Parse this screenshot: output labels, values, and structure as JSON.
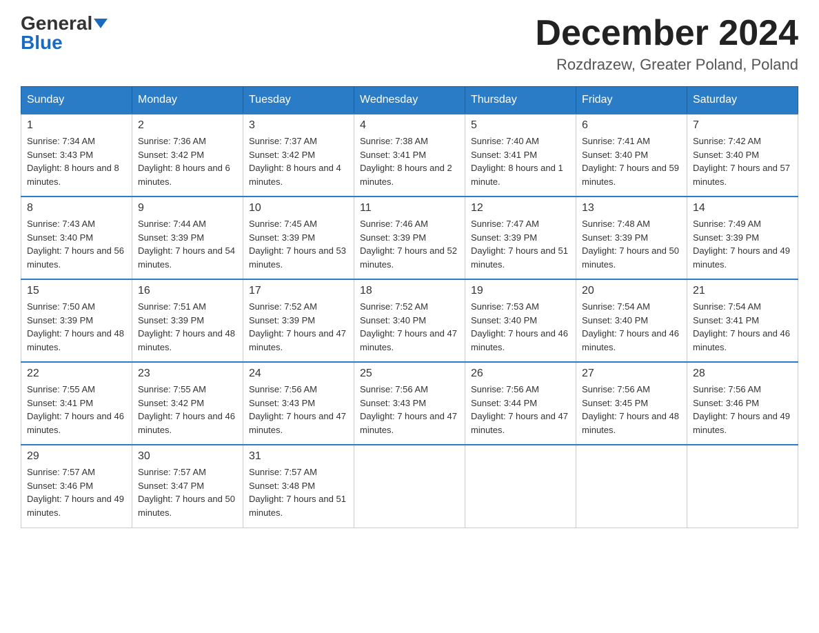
{
  "logo": {
    "general": "General",
    "blue": "Blue"
  },
  "title": "December 2024",
  "location": "Rozdrazew, Greater Poland, Poland",
  "days_of_week": [
    "Sunday",
    "Monday",
    "Tuesday",
    "Wednesday",
    "Thursday",
    "Friday",
    "Saturday"
  ],
  "weeks": [
    [
      {
        "day": "1",
        "sunrise": "7:34 AM",
        "sunset": "3:43 PM",
        "daylight": "8 hours and 8 minutes."
      },
      {
        "day": "2",
        "sunrise": "7:36 AM",
        "sunset": "3:42 PM",
        "daylight": "8 hours and 6 minutes."
      },
      {
        "day": "3",
        "sunrise": "7:37 AM",
        "sunset": "3:42 PM",
        "daylight": "8 hours and 4 minutes."
      },
      {
        "day": "4",
        "sunrise": "7:38 AM",
        "sunset": "3:41 PM",
        "daylight": "8 hours and 2 minutes."
      },
      {
        "day": "5",
        "sunrise": "7:40 AM",
        "sunset": "3:41 PM",
        "daylight": "8 hours and 1 minute."
      },
      {
        "day": "6",
        "sunrise": "7:41 AM",
        "sunset": "3:40 PM",
        "daylight": "7 hours and 59 minutes."
      },
      {
        "day": "7",
        "sunrise": "7:42 AM",
        "sunset": "3:40 PM",
        "daylight": "7 hours and 57 minutes."
      }
    ],
    [
      {
        "day": "8",
        "sunrise": "7:43 AM",
        "sunset": "3:40 PM",
        "daylight": "7 hours and 56 minutes."
      },
      {
        "day": "9",
        "sunrise": "7:44 AM",
        "sunset": "3:39 PM",
        "daylight": "7 hours and 54 minutes."
      },
      {
        "day": "10",
        "sunrise": "7:45 AM",
        "sunset": "3:39 PM",
        "daylight": "7 hours and 53 minutes."
      },
      {
        "day": "11",
        "sunrise": "7:46 AM",
        "sunset": "3:39 PM",
        "daylight": "7 hours and 52 minutes."
      },
      {
        "day": "12",
        "sunrise": "7:47 AM",
        "sunset": "3:39 PM",
        "daylight": "7 hours and 51 minutes."
      },
      {
        "day": "13",
        "sunrise": "7:48 AM",
        "sunset": "3:39 PM",
        "daylight": "7 hours and 50 minutes."
      },
      {
        "day": "14",
        "sunrise": "7:49 AM",
        "sunset": "3:39 PM",
        "daylight": "7 hours and 49 minutes."
      }
    ],
    [
      {
        "day": "15",
        "sunrise": "7:50 AM",
        "sunset": "3:39 PM",
        "daylight": "7 hours and 48 minutes."
      },
      {
        "day": "16",
        "sunrise": "7:51 AM",
        "sunset": "3:39 PM",
        "daylight": "7 hours and 48 minutes."
      },
      {
        "day": "17",
        "sunrise": "7:52 AM",
        "sunset": "3:39 PM",
        "daylight": "7 hours and 47 minutes."
      },
      {
        "day": "18",
        "sunrise": "7:52 AM",
        "sunset": "3:40 PM",
        "daylight": "7 hours and 47 minutes."
      },
      {
        "day": "19",
        "sunrise": "7:53 AM",
        "sunset": "3:40 PM",
        "daylight": "7 hours and 46 minutes."
      },
      {
        "day": "20",
        "sunrise": "7:54 AM",
        "sunset": "3:40 PM",
        "daylight": "7 hours and 46 minutes."
      },
      {
        "day": "21",
        "sunrise": "7:54 AM",
        "sunset": "3:41 PM",
        "daylight": "7 hours and 46 minutes."
      }
    ],
    [
      {
        "day": "22",
        "sunrise": "7:55 AM",
        "sunset": "3:41 PM",
        "daylight": "7 hours and 46 minutes."
      },
      {
        "day": "23",
        "sunrise": "7:55 AM",
        "sunset": "3:42 PM",
        "daylight": "7 hours and 46 minutes."
      },
      {
        "day": "24",
        "sunrise": "7:56 AM",
        "sunset": "3:43 PM",
        "daylight": "7 hours and 47 minutes."
      },
      {
        "day": "25",
        "sunrise": "7:56 AM",
        "sunset": "3:43 PM",
        "daylight": "7 hours and 47 minutes."
      },
      {
        "day": "26",
        "sunrise": "7:56 AM",
        "sunset": "3:44 PM",
        "daylight": "7 hours and 47 minutes."
      },
      {
        "day": "27",
        "sunrise": "7:56 AM",
        "sunset": "3:45 PM",
        "daylight": "7 hours and 48 minutes."
      },
      {
        "day": "28",
        "sunrise": "7:56 AM",
        "sunset": "3:46 PM",
        "daylight": "7 hours and 49 minutes."
      }
    ],
    [
      {
        "day": "29",
        "sunrise": "7:57 AM",
        "sunset": "3:46 PM",
        "daylight": "7 hours and 49 minutes."
      },
      {
        "day": "30",
        "sunrise": "7:57 AM",
        "sunset": "3:47 PM",
        "daylight": "7 hours and 50 minutes."
      },
      {
        "day": "31",
        "sunrise": "7:57 AM",
        "sunset": "3:48 PM",
        "daylight": "7 hours and 51 minutes."
      },
      null,
      null,
      null,
      null
    ]
  ],
  "labels": {
    "sunrise": "Sunrise:",
    "sunset": "Sunset:",
    "daylight": "Daylight:"
  }
}
